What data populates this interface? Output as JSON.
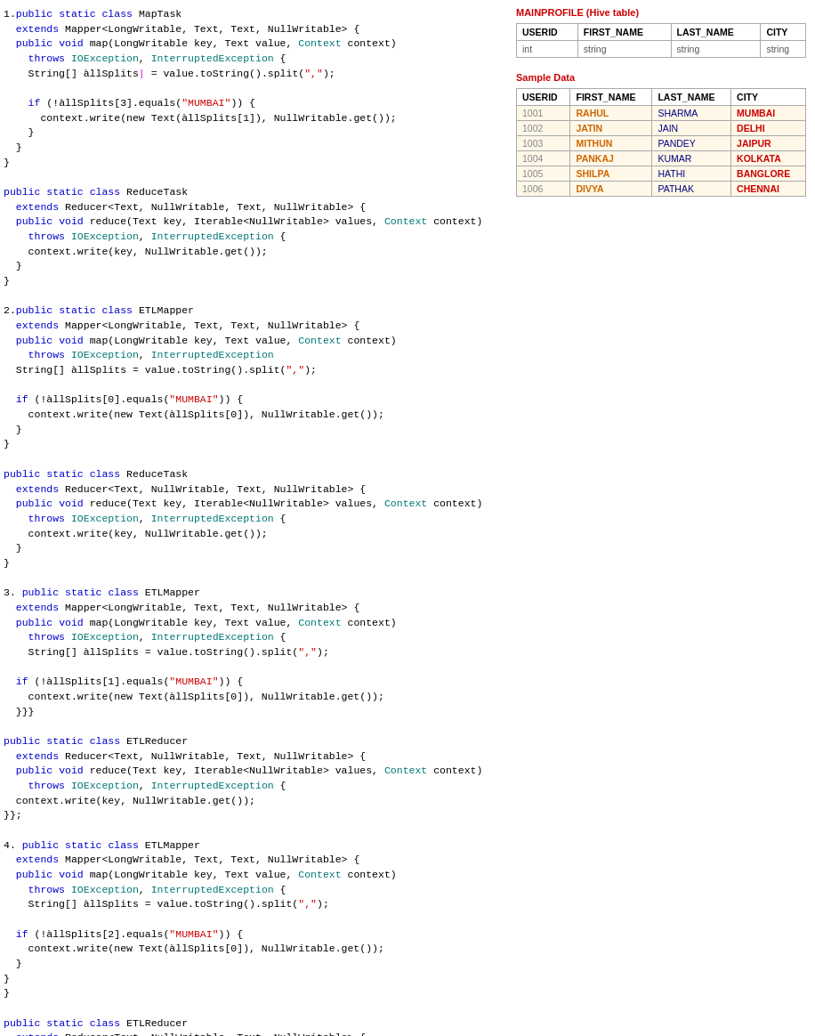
{
  "right_panel": {
    "title": "MAINPROFILE (Hive table)",
    "schema": {
      "headers": [
        "USERID",
        "FIRST_NAME",
        "LAST_NAME",
        "CITY"
      ],
      "types": [
        "int",
        "string",
        "string",
        "string"
      ]
    },
    "sample_title": "Sample Data",
    "sample_headers": [
      "USERID",
      "FIRST_NAME",
      "LAST_NAME",
      "CITY"
    ],
    "sample_rows": [
      [
        "1001",
        "RAHUL",
        "SHARMA",
        "MUMBAI"
      ],
      [
        "1002",
        "JATIN",
        "JAIN",
        "DELHI"
      ],
      [
        "1003",
        "MITHUN",
        "PANDEY",
        "JAIPUR"
      ],
      [
        "1004",
        "PANKAJ",
        "KUMAR",
        "KOLKATA"
      ],
      [
        "1005",
        "SHILPA",
        "HATHI",
        "BANGLORE"
      ],
      [
        "1006",
        "DIVYA",
        "PATHAK",
        "CHENNAI"
      ]
    ]
  }
}
